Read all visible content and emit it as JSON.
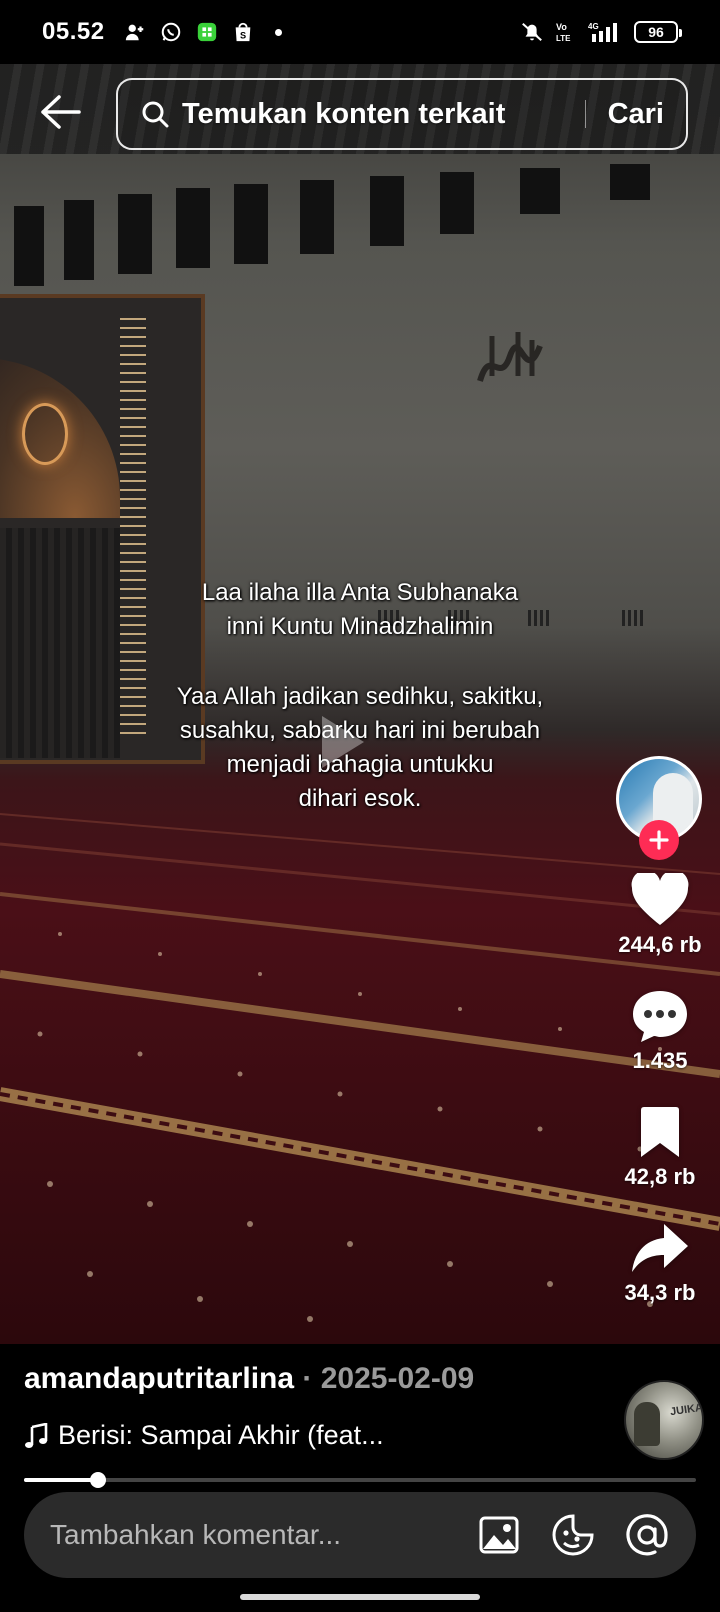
{
  "status_bar": {
    "time": "05.52",
    "battery": "96",
    "left_icons": [
      "add-contact-icon",
      "whatsapp-icon",
      "calculator-app-icon",
      "shopee-icon",
      "notification-dot"
    ],
    "right_icons": [
      "mute-icon",
      "volte-icon",
      "signal-4g-icon",
      "battery-icon"
    ]
  },
  "search": {
    "placeholder": "Temukan konten terkait",
    "button_label": "Cari"
  },
  "video": {
    "caption_line1": "Laa ilaha illa Anta Subhanaka",
    "caption_line2": "inni Kuntu Minadzhalimin",
    "caption_line3": "Yaa Allah jadikan sedihku, sakitku,",
    "caption_line4": "susahku, sabarku hari ini berubah",
    "caption_line5": "menjadi bahagia untukku",
    "caption_line6": "dihari esok."
  },
  "actions": {
    "likes": "244,6 rb",
    "comments": "1.435",
    "saves": "42,8 rb",
    "shares": "34,3 rb"
  },
  "post": {
    "author": "amandaputritarlina",
    "separator": " · ",
    "date": "2025-02-09",
    "music": "Berisi: Sampai Akhir (feat...",
    "progress": 0.11
  },
  "comment": {
    "placeholder": "Tambahkan komentar..."
  },
  "colors": {
    "follow": "#fe2c55",
    "comment_bar": "#2b2b2b",
    "date_text": "#9a9a9a"
  }
}
